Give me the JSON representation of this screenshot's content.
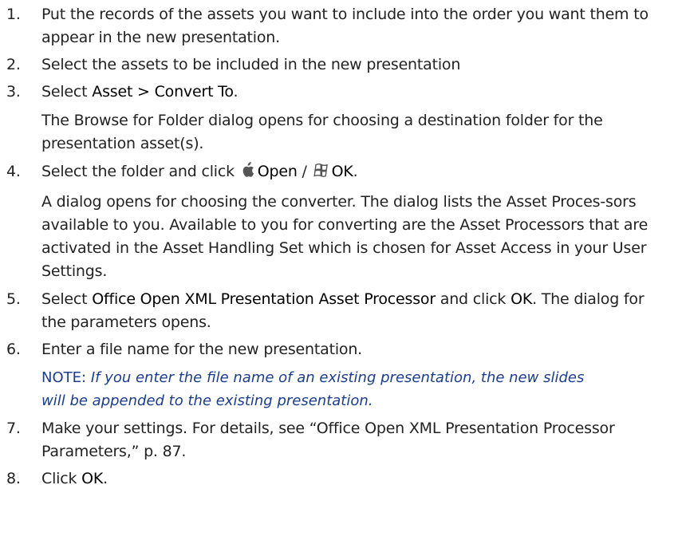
{
  "steps": [
    {
      "number": "1.",
      "text": "Put the records of the assets you want to include into the order you want them to appear in the new presentation."
    },
    {
      "number": "2.",
      "text": "Select the assets to be included in the new presentation"
    },
    {
      "number": "3.",
      "pre": "Select ",
      "ui": "Asset > Convert To",
      "post": ".",
      "detail": "The Browse for Folder dialog opens for choosing a destination folder for the presentation asset(s)."
    },
    {
      "number": "4.",
      "pre": "Select the folder and click ",
      "ui_mac": "Open",
      "separator": " / ",
      "ui_win": "OK",
      "post": ".",
      "icon_mac": "apple-icon",
      "icon_win": "windows-icon",
      "detail": "A dialog opens for choosing the converter. The dialog lists the Asset Proces-sors available to you. Available to you for converting are the Asset Processors that are activated in the Asset Handling Set which is chosen for Asset Access in your User Settings."
    },
    {
      "number": "5.",
      "pre": "Select ",
      "ui": "Office Open XML Presentation Asset Processor",
      "mid": " and click ",
      "ui2": "OK",
      "post": ". The dialog for the parameters opens."
    },
    {
      "number": "6.",
      "text": "Enter a file name for the new presentation.",
      "note_label": "NOTE:",
      "note_text": "If you enter the file name of an existing presentation, the new slides will be appended to the existing presentation."
    },
    {
      "number": "7.",
      "text": "Make your settings. For details, see “Office Open XML Presentation Processor Parameters,” p. 87."
    },
    {
      "number": "8.",
      "pre": "Click ",
      "ui": "OK",
      "post": "."
    }
  ],
  "colors": {
    "text": "#222222",
    "note": "#1a3d8f",
    "icon": "#555555"
  }
}
